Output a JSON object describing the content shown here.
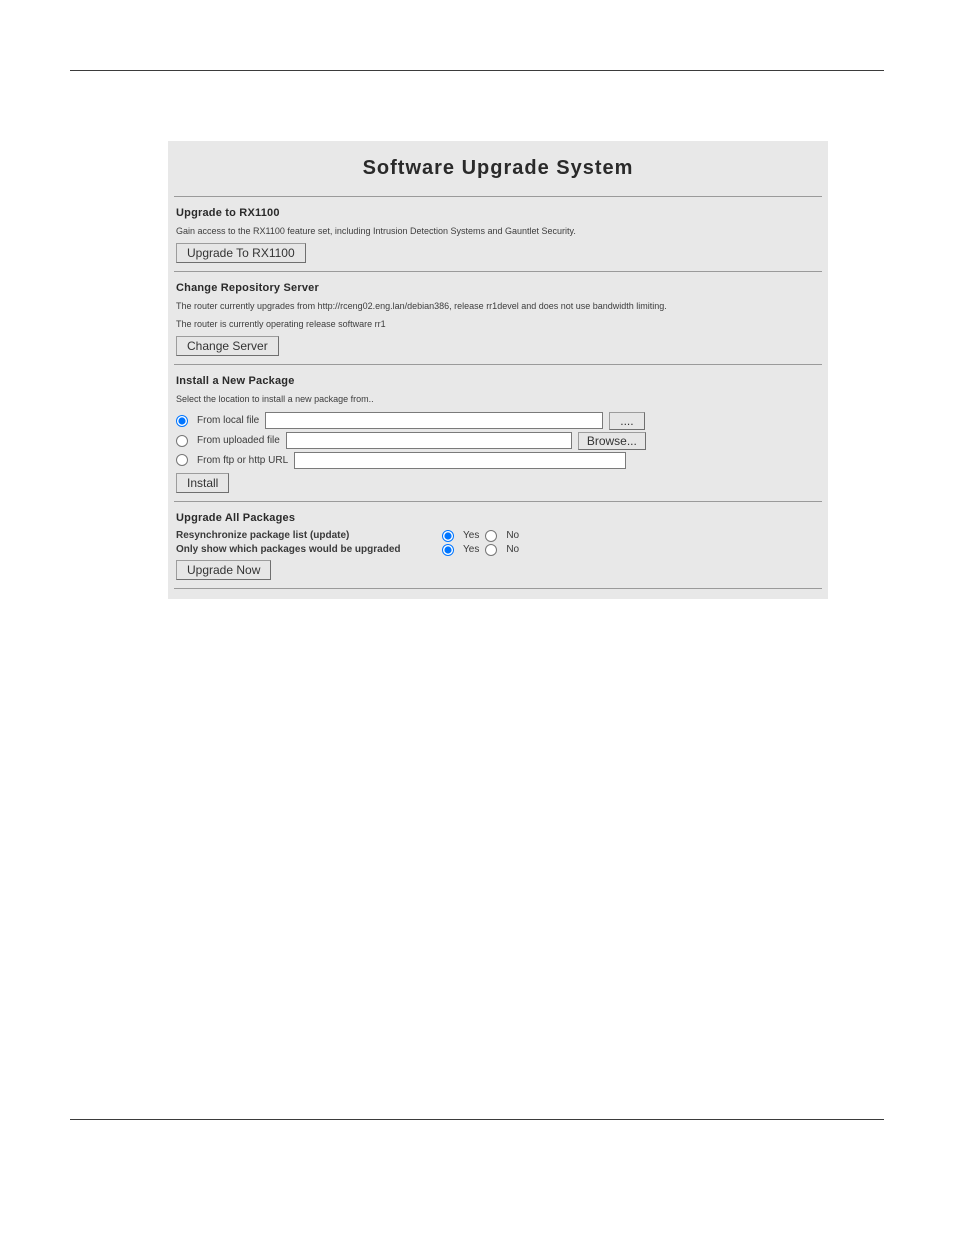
{
  "page": {
    "title": "Software Upgrade System"
  },
  "upgrade_rx1100": {
    "heading": "Upgrade to RX1100",
    "text": "Gain access to the RX1100 feature set, including Intrusion Detection Systems and Gauntlet Security.",
    "button": "Upgrade To RX1100"
  },
  "change_server": {
    "heading": "Change Repository Server",
    "line1": "The router currently upgrades from http://rceng02.eng.lan/debian386, release rr1devel and does not use bandwidth limiting.",
    "line2": "The router is currently operating release software rr1",
    "button": "Change Server"
  },
  "install_package": {
    "heading": "Install a New Package",
    "prompt": "Select the location to install a new package from..",
    "options": {
      "local": "From local file",
      "uploaded": "From uploaded file",
      "url": "From ftp or http URL"
    },
    "local_button": "....",
    "browse_button": "Browse...",
    "install_button": "Install"
  },
  "upgrade_all": {
    "heading": "Upgrade All Packages",
    "row1_label": "Resynchronize package list (update)",
    "row2_label": "Only show which packages would be upgraded",
    "yes": "Yes",
    "no": "No",
    "button": "Upgrade Now"
  }
}
